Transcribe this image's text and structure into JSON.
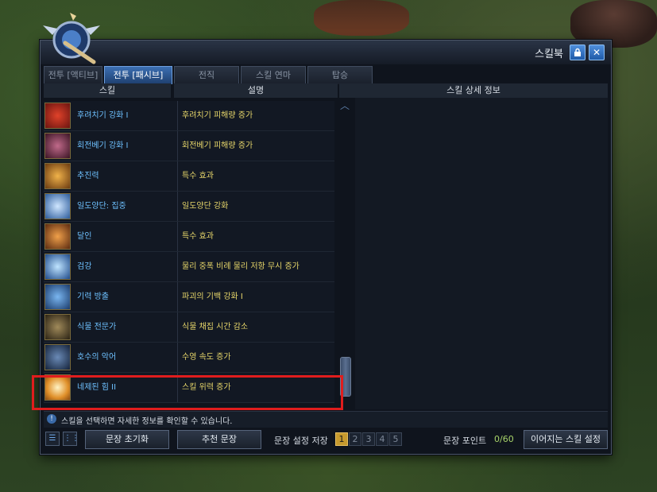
{
  "window": {
    "title": "스킬북"
  },
  "icons": {
    "lock": "lock-icon",
    "close": "close-icon",
    "info": "info-icon",
    "emblem": "winged-sword-emblem-icon"
  },
  "tabs": [
    {
      "label": "전투 [액티브]",
      "active": false
    },
    {
      "label": "전투 [패시브]",
      "active": true
    },
    {
      "label": "전직",
      "active": false
    },
    {
      "label": "스킬 연마",
      "active": false
    },
    {
      "label": "탑승",
      "active": false
    }
  ],
  "columns": {
    "skill": "스킬",
    "description": "설명",
    "detail": "스킬 상세 정보"
  },
  "skills": [
    {
      "name": "후려치기 강화 I",
      "desc": "후려치기 피해량 증가",
      "color": "#b8201a"
    },
    {
      "name": "회전베기 강화 I",
      "desc": "회전베기 피해량 증가",
      "color": "#6a2a3a"
    },
    {
      "name": "추진력",
      "desc": "특수 효과",
      "color": "#b5822a"
    },
    {
      "name": "일도양단: 집중",
      "desc": "일도양단 강화",
      "color": "#4a8ad6"
    },
    {
      "name": "달인",
      "desc": "특수 효과",
      "color": "#c46a1a"
    },
    {
      "name": "검강",
      "desc": "물리 중폭 비례 물리 저항 무시 증가",
      "color": "#3e86c8"
    },
    {
      "name": "기력 방출",
      "desc": "파괴의 기백 강화 I",
      "color": "#3a6ea8"
    },
    {
      "name": "식물 전문가",
      "desc": "식물 채집 시간 감소",
      "color": "#5a4a2a"
    },
    {
      "name": "호수의 악어",
      "desc": "수영 속도 증가",
      "color": "#2a4a7a"
    },
    {
      "name": "네제된 힘 II",
      "desc": "스킬 위력 증가",
      "color": "#e09a2a"
    }
  ],
  "hint": "스킬을 선택하면 자세한 정보를 확인할 수 있습니다.",
  "bottom": {
    "reset_label": "문장 초기화",
    "recommend_label": "추천 문장",
    "save_label": "문장 설정 저장",
    "slots": [
      "1",
      "2",
      "3",
      "4",
      "5"
    ],
    "active_slot": 1,
    "points_label": "문장 포인트",
    "points_value": "0/60",
    "continue_label": "이어지는 스킬 설정"
  },
  "colors": {
    "accent": "#3c6fb3",
    "highlight": "#e01d1d",
    "name_text": "#6ec1ff",
    "desc_text": "#e7d66a"
  }
}
